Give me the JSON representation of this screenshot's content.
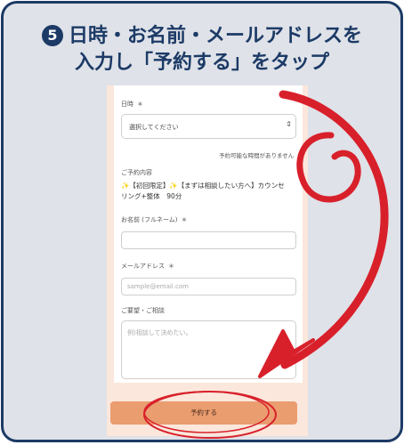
{
  "header": {
    "step_number": "5",
    "line1": "日時・お名前・メールアドレスを",
    "line2": "入力し「予約する」をタップ"
  },
  "form": {
    "datetime_label": "日時",
    "required_mark": "＊",
    "datetime_select_value": "選択してください",
    "availability_note": "予約可能な時間がありません",
    "booking_content_label": "ご予約内容",
    "course_line1": "【初回限定】",
    "course_line2": "【まずは相談したい方へ】カウンセ",
    "course_line3": "リング+整体　90分",
    "name_label": "お名前 (フルネーム)",
    "email_label": "メールアドレス",
    "email_placeholder": "sample@email.com",
    "request_label": "ご要望・ご相談",
    "request_placeholder": "例)相談して決めたい。",
    "submit_label": "予約する"
  },
  "colors": {
    "header_navy": "#1c3a66",
    "card_bg": "#dfe2e8",
    "phone_bg": "#fbe7dc",
    "button_orange": "#ea9d6f",
    "annotation_red": "#d8202b"
  }
}
